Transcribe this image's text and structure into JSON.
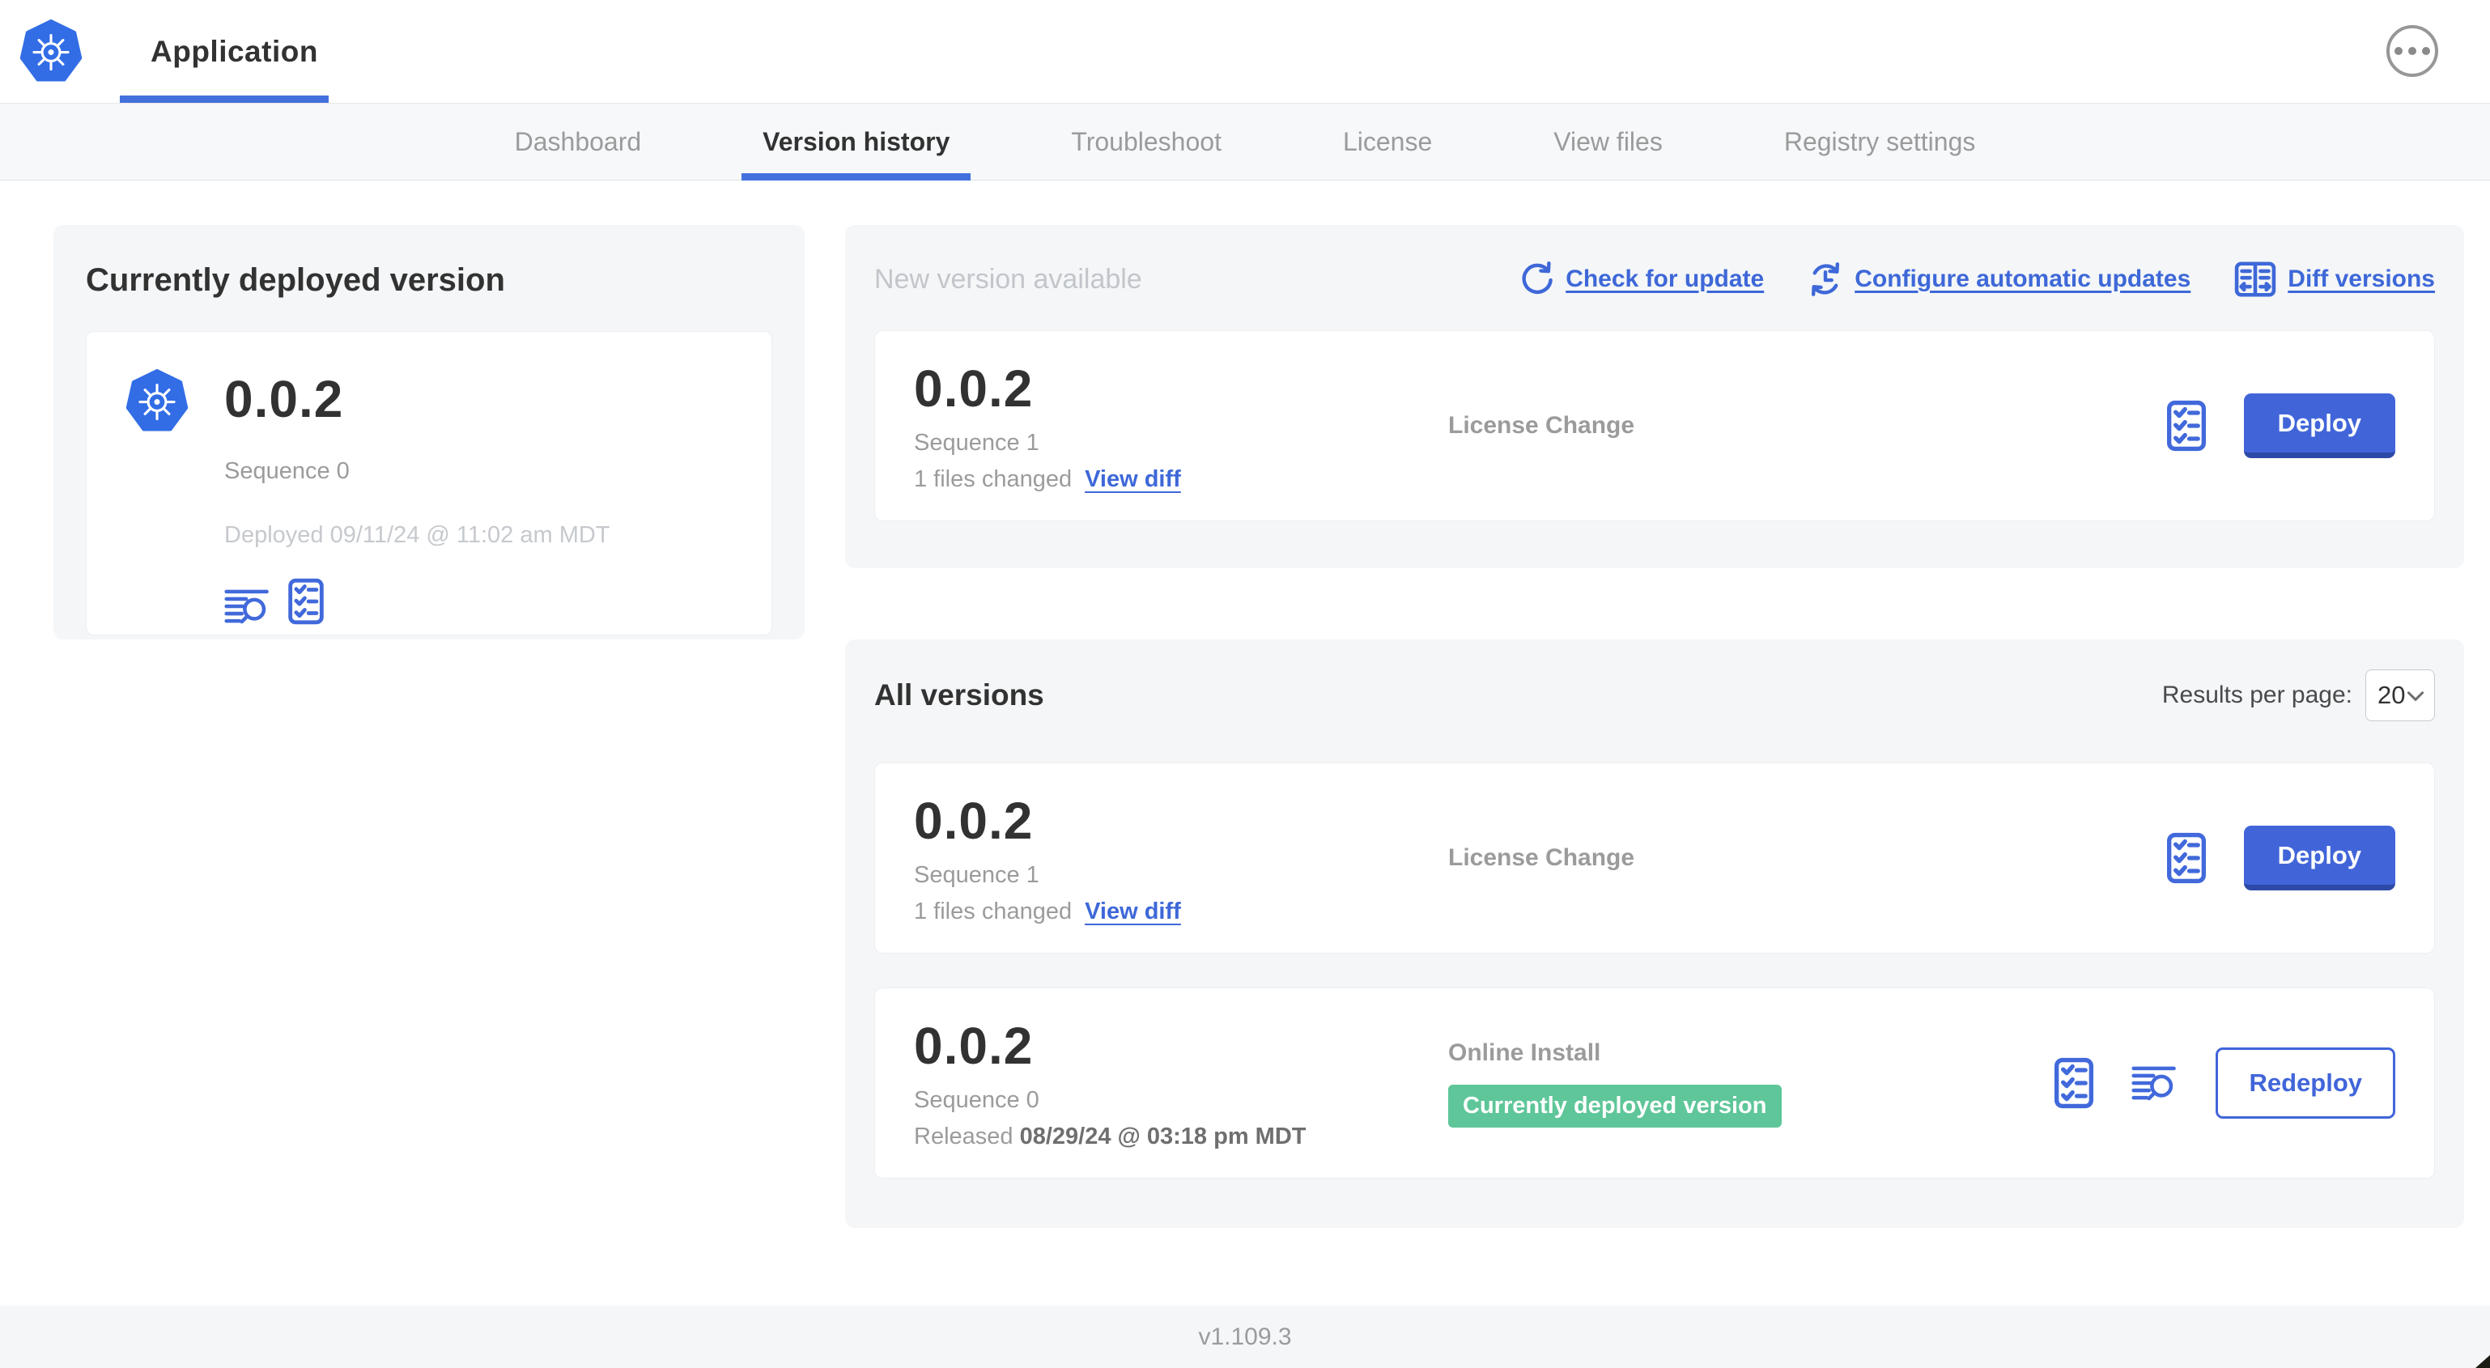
{
  "header": {
    "app_title": "Application",
    "logo_icon": "kubernetes-logo",
    "menu_icon": "ellipsis-menu-icon"
  },
  "nav": {
    "tabs": [
      {
        "label": "Dashboard",
        "active": false
      },
      {
        "label": "Version history",
        "active": true
      },
      {
        "label": "Troubleshoot",
        "active": false
      },
      {
        "label": "License",
        "active": false
      },
      {
        "label": "View files",
        "active": false
      },
      {
        "label": "Registry settings",
        "active": false
      }
    ]
  },
  "current_version_panel": {
    "title": "Currently deployed version",
    "version": "0.0.2",
    "sequence": "Sequence 0",
    "deployed": "Deployed 09/11/24 @ 11:02 am MDT",
    "icons": [
      "logs-icon",
      "preflight-checklist-icon"
    ]
  },
  "new_version_panel": {
    "title": "New version available",
    "actions": [
      {
        "label": "Check for update",
        "icon": "refresh-icon"
      },
      {
        "label": "Configure automatic updates",
        "icon": "schedule-update-icon"
      },
      {
        "label": "Diff versions",
        "icon": "diff-icon"
      }
    ],
    "row": {
      "version": "0.0.2",
      "sequence": "Sequence 1",
      "files_changed": "1 files changed",
      "view_diff_label": "View diff",
      "source": "License Change",
      "deploy_label": "Deploy",
      "icons": [
        "preflight-checklist-icon"
      ]
    }
  },
  "all_versions_panel": {
    "title": "All versions",
    "results_per_page_label": "Results per page:",
    "results_per_page_value": "20",
    "rows": [
      {
        "version": "0.0.2",
        "sequence": "Sequence 1",
        "files_changed": "1 files changed",
        "view_diff_label": "View diff",
        "source": "License Change",
        "action_label": "Deploy",
        "icons": [
          "preflight-checklist-icon"
        ]
      },
      {
        "version": "0.0.2",
        "sequence": "Sequence 0",
        "released_prefix": "Released",
        "released_date": "08/29/24 @ 03:18 pm MDT",
        "source": "Online Install",
        "badge": "Currently deployed version",
        "action_label": "Redeploy",
        "icons": [
          "preflight-checklist-icon",
          "logs-icon"
        ]
      }
    ]
  },
  "footer": {
    "version": "v1.109.3"
  },
  "colors": {
    "accent_blue": "#4165d9",
    "link_blue": "#3e68d8",
    "badge_green": "#5ec698",
    "text_dark": "#323232",
    "text_gray": "#9b9b9b",
    "panel_gray": "#f4f6f8",
    "logo_blue": "#326de6"
  }
}
